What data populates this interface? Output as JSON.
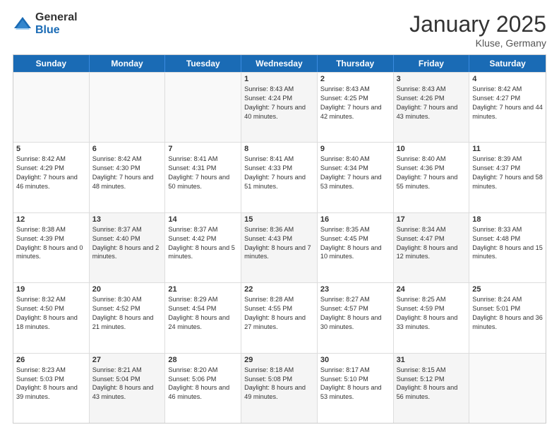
{
  "logo": {
    "general": "General",
    "blue": "Blue"
  },
  "title": {
    "month_year": "January 2025",
    "location": "Kluse, Germany"
  },
  "weekdays": [
    "Sunday",
    "Monday",
    "Tuesday",
    "Wednesday",
    "Thursday",
    "Friday",
    "Saturday"
  ],
  "weeks": [
    [
      {
        "day": "",
        "sunrise": "",
        "sunset": "",
        "daylight": "",
        "empty": true
      },
      {
        "day": "",
        "sunrise": "",
        "sunset": "",
        "daylight": "",
        "empty": true
      },
      {
        "day": "",
        "sunrise": "",
        "sunset": "",
        "daylight": "",
        "empty": true
      },
      {
        "day": "1",
        "sunrise": "Sunrise: 8:43 AM",
        "sunset": "Sunset: 4:24 PM",
        "daylight": "Daylight: 7 hours and 40 minutes.",
        "empty": false
      },
      {
        "day": "2",
        "sunrise": "Sunrise: 8:43 AM",
        "sunset": "Sunset: 4:25 PM",
        "daylight": "Daylight: 7 hours and 42 minutes.",
        "empty": false
      },
      {
        "day": "3",
        "sunrise": "Sunrise: 8:43 AM",
        "sunset": "Sunset: 4:26 PM",
        "daylight": "Daylight: 7 hours and 43 minutes.",
        "empty": false
      },
      {
        "day": "4",
        "sunrise": "Sunrise: 8:42 AM",
        "sunset": "Sunset: 4:27 PM",
        "daylight": "Daylight: 7 hours and 44 minutes.",
        "empty": false
      }
    ],
    [
      {
        "day": "5",
        "sunrise": "Sunrise: 8:42 AM",
        "sunset": "Sunset: 4:29 PM",
        "daylight": "Daylight: 7 hours and 46 minutes.",
        "empty": false
      },
      {
        "day": "6",
        "sunrise": "Sunrise: 8:42 AM",
        "sunset": "Sunset: 4:30 PM",
        "daylight": "Daylight: 7 hours and 48 minutes.",
        "empty": false
      },
      {
        "day": "7",
        "sunrise": "Sunrise: 8:41 AM",
        "sunset": "Sunset: 4:31 PM",
        "daylight": "Daylight: 7 hours and 50 minutes.",
        "empty": false
      },
      {
        "day": "8",
        "sunrise": "Sunrise: 8:41 AM",
        "sunset": "Sunset: 4:33 PM",
        "daylight": "Daylight: 7 hours and 51 minutes.",
        "empty": false
      },
      {
        "day": "9",
        "sunrise": "Sunrise: 8:40 AM",
        "sunset": "Sunset: 4:34 PM",
        "daylight": "Daylight: 7 hours and 53 minutes.",
        "empty": false
      },
      {
        "day": "10",
        "sunrise": "Sunrise: 8:40 AM",
        "sunset": "Sunset: 4:36 PM",
        "daylight": "Daylight: 7 hours and 55 minutes.",
        "empty": false
      },
      {
        "day": "11",
        "sunrise": "Sunrise: 8:39 AM",
        "sunset": "Sunset: 4:37 PM",
        "daylight": "Daylight: 7 hours and 58 minutes.",
        "empty": false
      }
    ],
    [
      {
        "day": "12",
        "sunrise": "Sunrise: 8:38 AM",
        "sunset": "Sunset: 4:39 PM",
        "daylight": "Daylight: 8 hours and 0 minutes.",
        "empty": false
      },
      {
        "day": "13",
        "sunrise": "Sunrise: 8:37 AM",
        "sunset": "Sunset: 4:40 PM",
        "daylight": "Daylight: 8 hours and 2 minutes.",
        "empty": false
      },
      {
        "day": "14",
        "sunrise": "Sunrise: 8:37 AM",
        "sunset": "Sunset: 4:42 PM",
        "daylight": "Daylight: 8 hours and 5 minutes.",
        "empty": false
      },
      {
        "day": "15",
        "sunrise": "Sunrise: 8:36 AM",
        "sunset": "Sunset: 4:43 PM",
        "daylight": "Daylight: 8 hours and 7 minutes.",
        "empty": false
      },
      {
        "day": "16",
        "sunrise": "Sunrise: 8:35 AM",
        "sunset": "Sunset: 4:45 PM",
        "daylight": "Daylight: 8 hours and 10 minutes.",
        "empty": false
      },
      {
        "day": "17",
        "sunrise": "Sunrise: 8:34 AM",
        "sunset": "Sunset: 4:47 PM",
        "daylight": "Daylight: 8 hours and 12 minutes.",
        "empty": false
      },
      {
        "day": "18",
        "sunrise": "Sunrise: 8:33 AM",
        "sunset": "Sunset: 4:48 PM",
        "daylight": "Daylight: 8 hours and 15 minutes.",
        "empty": false
      }
    ],
    [
      {
        "day": "19",
        "sunrise": "Sunrise: 8:32 AM",
        "sunset": "Sunset: 4:50 PM",
        "daylight": "Daylight: 8 hours and 18 minutes.",
        "empty": false
      },
      {
        "day": "20",
        "sunrise": "Sunrise: 8:30 AM",
        "sunset": "Sunset: 4:52 PM",
        "daylight": "Daylight: 8 hours and 21 minutes.",
        "empty": false
      },
      {
        "day": "21",
        "sunrise": "Sunrise: 8:29 AM",
        "sunset": "Sunset: 4:54 PM",
        "daylight": "Daylight: 8 hours and 24 minutes.",
        "empty": false
      },
      {
        "day": "22",
        "sunrise": "Sunrise: 8:28 AM",
        "sunset": "Sunset: 4:55 PM",
        "daylight": "Daylight: 8 hours and 27 minutes.",
        "empty": false
      },
      {
        "day": "23",
        "sunrise": "Sunrise: 8:27 AM",
        "sunset": "Sunset: 4:57 PM",
        "daylight": "Daylight: 8 hours and 30 minutes.",
        "empty": false
      },
      {
        "day": "24",
        "sunrise": "Sunrise: 8:25 AM",
        "sunset": "Sunset: 4:59 PM",
        "daylight": "Daylight: 8 hours and 33 minutes.",
        "empty": false
      },
      {
        "day": "25",
        "sunrise": "Sunrise: 8:24 AM",
        "sunset": "Sunset: 5:01 PM",
        "daylight": "Daylight: 8 hours and 36 minutes.",
        "empty": false
      }
    ],
    [
      {
        "day": "26",
        "sunrise": "Sunrise: 8:23 AM",
        "sunset": "Sunset: 5:03 PM",
        "daylight": "Daylight: 8 hours and 39 minutes.",
        "empty": false
      },
      {
        "day": "27",
        "sunrise": "Sunrise: 8:21 AM",
        "sunset": "Sunset: 5:04 PM",
        "daylight": "Daylight: 8 hours and 43 minutes.",
        "empty": false
      },
      {
        "day": "28",
        "sunrise": "Sunrise: 8:20 AM",
        "sunset": "Sunset: 5:06 PM",
        "daylight": "Daylight: 8 hours and 46 minutes.",
        "empty": false
      },
      {
        "day": "29",
        "sunrise": "Sunrise: 8:18 AM",
        "sunset": "Sunset: 5:08 PM",
        "daylight": "Daylight: 8 hours and 49 minutes.",
        "empty": false
      },
      {
        "day": "30",
        "sunrise": "Sunrise: 8:17 AM",
        "sunset": "Sunset: 5:10 PM",
        "daylight": "Daylight: 8 hours and 53 minutes.",
        "empty": false
      },
      {
        "day": "31",
        "sunrise": "Sunrise: 8:15 AM",
        "sunset": "Sunset: 5:12 PM",
        "daylight": "Daylight: 8 hours and 56 minutes.",
        "empty": false
      },
      {
        "day": "",
        "sunrise": "",
        "sunset": "",
        "daylight": "",
        "empty": true
      }
    ]
  ]
}
